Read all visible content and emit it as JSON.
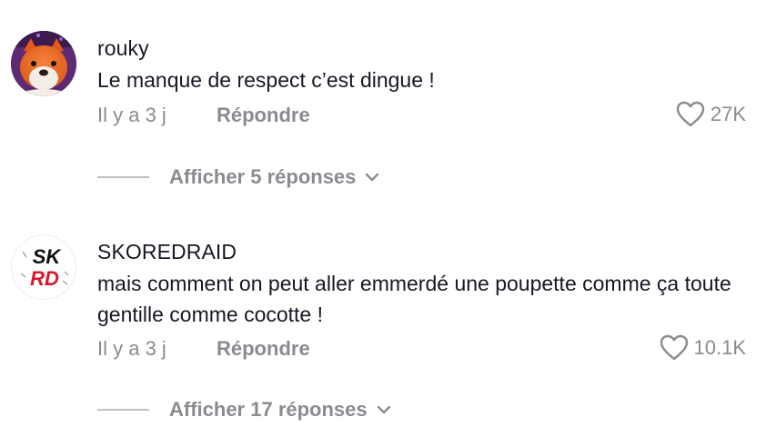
{
  "comments": [
    {
      "username": "rouky",
      "text": "Le manque de respect c’est dingue !",
      "time": "Il y a 3 j",
      "reply_label": "Répondre",
      "likes": "27K",
      "show_replies": "Afficher 5 réponses",
      "avatar_icon": "fox-plush-avatar"
    },
    {
      "username": "SKOREDRAID",
      "text": "mais comment on peut aller emmerdé une poupette comme ça toute gentille comme cocotte !",
      "time": "Il y a 3 j",
      "reply_label": "Répondre",
      "likes": "10.1K",
      "show_replies": "Afficher 17 réponses",
      "avatar_logo_line1": "SK",
      "avatar_logo_line2": "RD"
    }
  ],
  "colors": {
    "text": "#161823",
    "muted": "#8a8b91",
    "logo_red": "#d8182a"
  },
  "icons": [
    "heart-icon",
    "chevron-down-icon"
  ]
}
